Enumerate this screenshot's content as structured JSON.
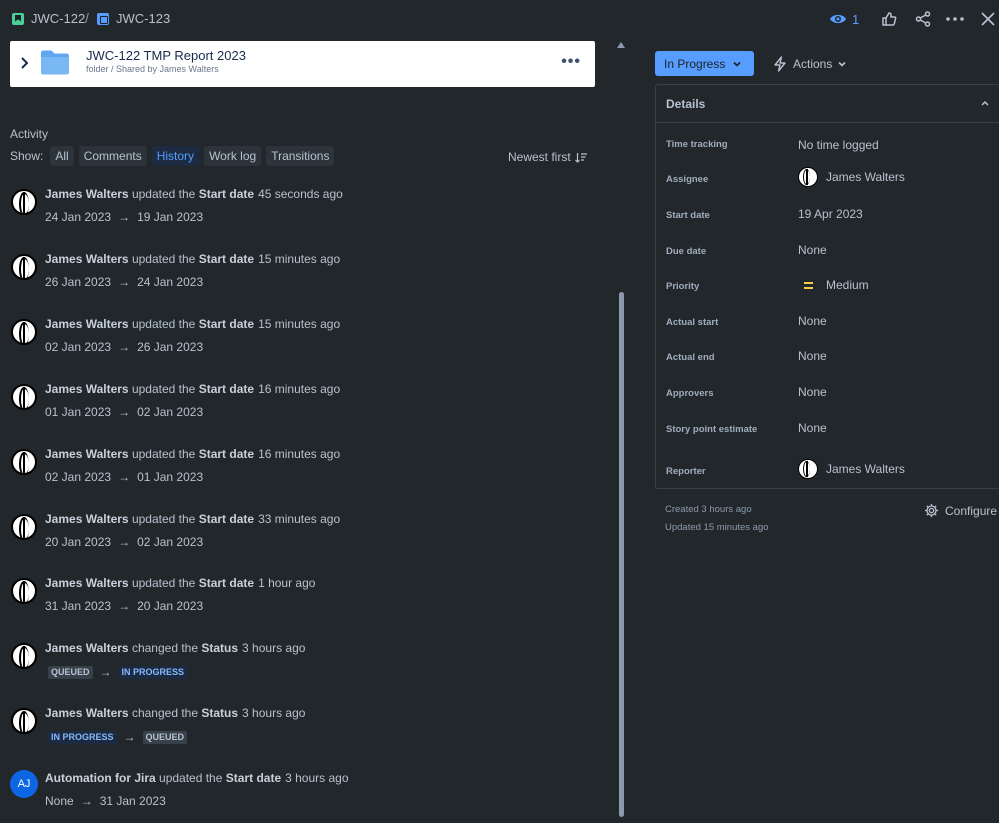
{
  "breadcrumb": {
    "parent": "JWC-122",
    "separator": "/",
    "current": "JWC-123"
  },
  "header": {
    "watch_count": "1"
  },
  "folder": {
    "title": "JWC-122 TMP Report 2023",
    "subtitle": "folder / Shared by James Walters"
  },
  "activity": {
    "title": "Activity",
    "show_label": "Show:",
    "filters": [
      "All",
      "Comments",
      "History",
      "Work log",
      "Transitions"
    ],
    "active_filter": "History",
    "sort_label": "Newest first",
    "entries": [
      {
        "author": "James Walters",
        "verb": "updated the",
        "field": "Start date",
        "ago": "45 seconds ago",
        "from": "24 Jan 2023",
        "to": "19 Jan 2023"
      },
      {
        "author": "James Walters",
        "verb": "updated the",
        "field": "Start date",
        "ago": "15 minutes ago",
        "from": "26 Jan 2023",
        "to": "24 Jan 2023"
      },
      {
        "author": "James Walters",
        "verb": "updated the",
        "field": "Start date",
        "ago": "15 minutes ago",
        "from": "02 Jan 2023",
        "to": "26 Jan 2023"
      },
      {
        "author": "James Walters",
        "verb": "updated the",
        "field": "Start date",
        "ago": "16 minutes ago",
        "from": "01 Jan 2023",
        "to": "02 Jan 2023"
      },
      {
        "author": "James Walters",
        "verb": "updated the",
        "field": "Start date",
        "ago": "16 minutes ago",
        "from": "02 Jan 2023",
        "to": "01 Jan 2023"
      },
      {
        "author": "James Walters",
        "verb": "updated the",
        "field": "Start date",
        "ago": "33 minutes ago",
        "from": "20 Jan 2023",
        "to": "02 Jan 2023"
      },
      {
        "author": "James Walters",
        "verb": "updated the",
        "field": "Start date",
        "ago": "1 hour ago",
        "from": "31 Jan 2023",
        "to": "20 Jan 2023"
      },
      {
        "author": "James Walters",
        "verb": "changed the",
        "field": "Status",
        "ago": "3 hours ago",
        "from": "QUEUED",
        "to": "IN PROGRESS"
      },
      {
        "author": "James Walters",
        "verb": "changed the",
        "field": "Status",
        "ago": "3 hours ago",
        "from": "IN PROGRESS",
        "to": "QUEUED"
      },
      {
        "author": "Automation for Jira",
        "verb": "updated the",
        "field": "Start date",
        "ago": "3 hours ago",
        "from": "None",
        "to": "31 Jan 2023",
        "avatar_initials": "AJ"
      }
    ],
    "arrow": "→"
  },
  "status_button": "In Progress",
  "actions_button": "Actions",
  "details": {
    "title": "Details",
    "rows": [
      {
        "label": "Time tracking",
        "value": "No time logged"
      },
      {
        "label": "Assignee",
        "value": "James Walters"
      },
      {
        "label": "Start date",
        "value": "19 Apr 2023"
      },
      {
        "label": "Due date",
        "value": "None"
      },
      {
        "label": "Priority",
        "value": "Medium"
      },
      {
        "label": "Actual start",
        "value": "None"
      },
      {
        "label": "Actual end",
        "value": "None"
      },
      {
        "label": "Approvers",
        "value": "None"
      },
      {
        "label": "Story point estimate",
        "value": "None"
      },
      {
        "label": "Reporter",
        "value": "James Walters"
      }
    ]
  },
  "meta": {
    "created": "Created 3 hours ago",
    "updated": "Updated 15 minutes ago",
    "configure": "Configure"
  },
  "colors": {
    "background": "#22272b",
    "accent": "#579dff",
    "priority_medium": "#f5cd47"
  },
  "icons": [
    "story-icon",
    "subtask-icon",
    "eye-icon",
    "thumbs-up-icon",
    "share-icon",
    "more-icon",
    "close-icon",
    "folder-icon",
    "lightning-icon",
    "gear-icon"
  ]
}
